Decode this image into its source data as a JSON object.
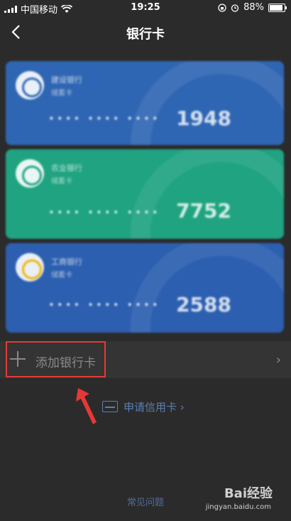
{
  "status_bar": {
    "carrier": "中国移动",
    "time": "19:25",
    "battery": "88%",
    "battery_level": 0.88
  },
  "header": {
    "title": "银行卡",
    "back_icon": "chevron-left-icon"
  },
  "cards": [
    {
      "bank_name": "建设银行",
      "card_type": "储蓄卡",
      "mask": "•••• •••• ••••",
      "last_digits": "1948",
      "color": "#2f66b3"
    },
    {
      "bank_name": "农业银行",
      "card_type": "储蓄卡",
      "mask": "•••• •••• ••••",
      "last_digits": "7752",
      "color": "#1fa380"
    },
    {
      "bank_name": "工商银行",
      "card_type": "储蓄卡",
      "mask": "•••• •••• ••••",
      "last_digits": "2588",
      "color": "#2c5fb0"
    }
  ],
  "add_card": {
    "label": "添加银行卡",
    "chevron": "›"
  },
  "apply_credit": {
    "label": "申请信用卡 ›",
    "icon": "credit-card-icon"
  },
  "faq": {
    "label": "常见问题"
  },
  "watermark": {
    "text": "Bai经验",
    "url": "jingyan.baidu.com"
  },
  "colors": {
    "highlight": "#e53935",
    "link": "#5b7fb4",
    "background": "#2b2b2b"
  }
}
